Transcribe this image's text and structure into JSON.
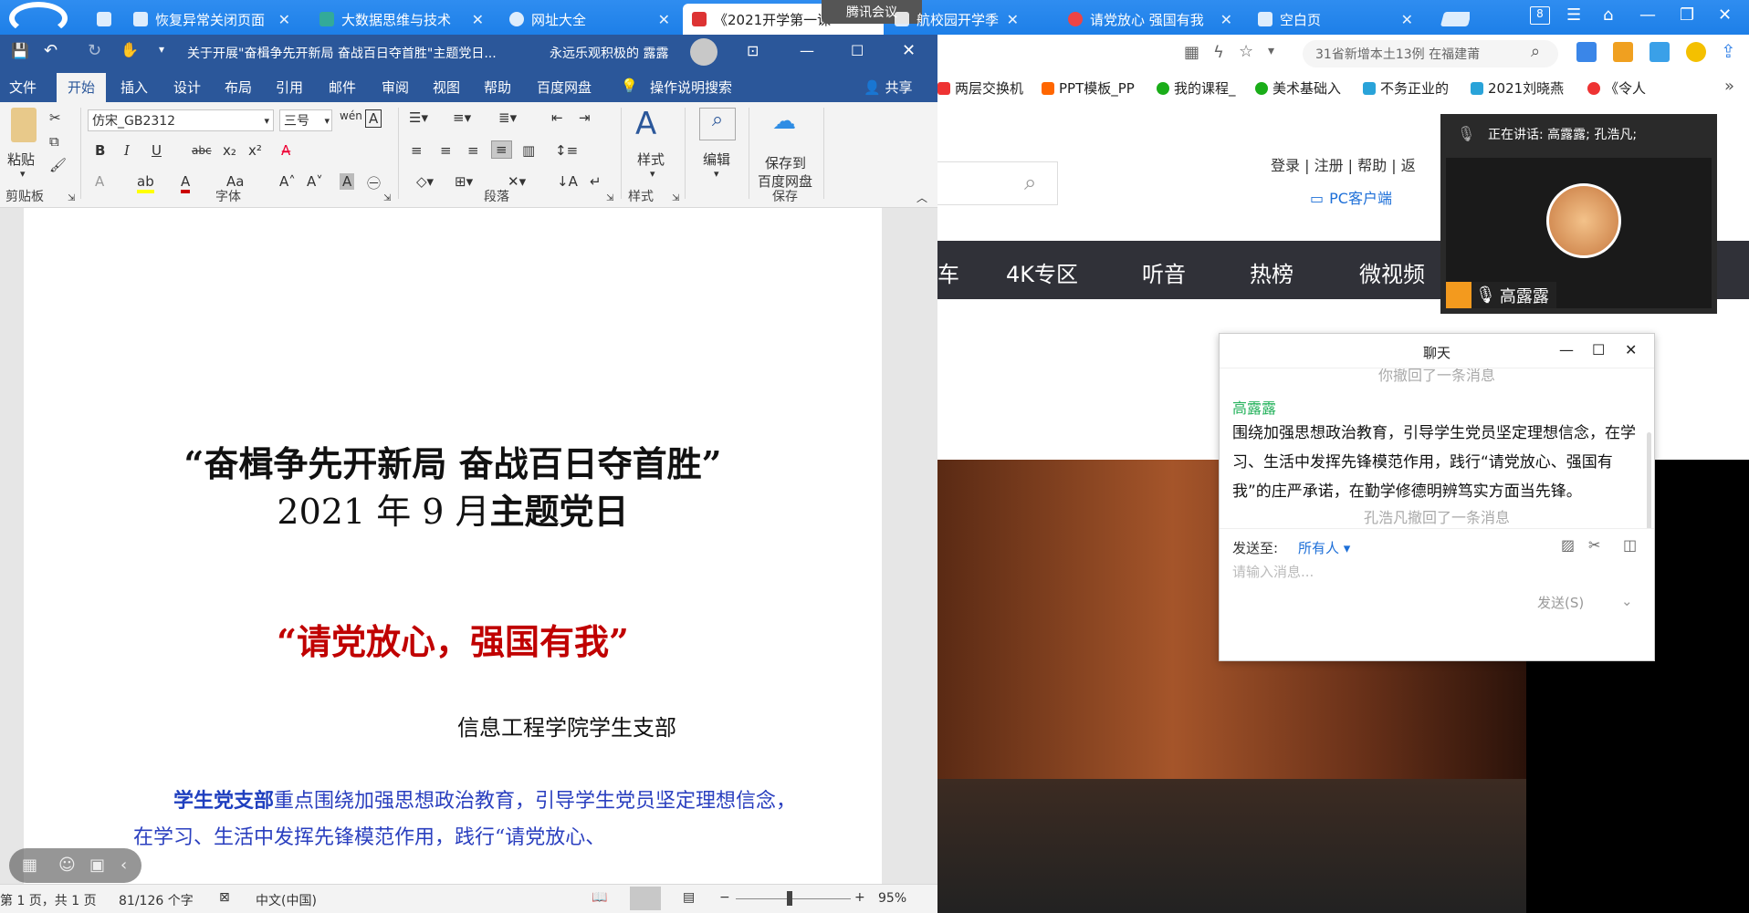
{
  "browser": {
    "tabs": [
      {
        "label": "恢复异常关闭页面"
      },
      {
        "label": "大数据思维与技术"
      },
      {
        "label": "网址大全"
      },
      {
        "label": "《2021开学第一课"
      },
      {
        "label": "航校园开学季 \"泛"
      },
      {
        "label": "请党放心 强国有我"
      },
      {
        "label": "空白页"
      }
    ],
    "meeting_app_label": "腾讯会议",
    "tab_counter": "8",
    "address_text": "31省新增本土13例 在福建莆",
    "bookmarks": [
      "两层交换机",
      "PPT模板_PP",
      "我的课程_",
      "美术基础入",
      "不务正业的",
      "2021刘晓燕",
      "《令人"
    ]
  },
  "website": {
    "login": "登录",
    "register": "注册",
    "help": "帮助",
    "back": "返",
    "pc_client": "PC客户端",
    "nav": [
      "车",
      "4K专区",
      "听音",
      "热榜",
      "微视频"
    ]
  },
  "word": {
    "title": "关于开展\"奋楫争先开新局  奋战百日夺首胜\"主题党日...",
    "user": "永远乐观积极的 露露",
    "tabs": [
      "文件",
      "开始",
      "插入",
      "设计",
      "布局",
      "引用",
      "邮件",
      "审阅",
      "视图",
      "帮助",
      "百度网盘"
    ],
    "tell_me": "操作说明搜索",
    "share": "共享",
    "ribbon": {
      "paste": "粘贴",
      "font_name": "仿宋_GB2312",
      "font_size": "三号",
      "styles": "样式",
      "edit": "编辑",
      "save_baidu": "保存到",
      "save_baidu2": "百度网盘",
      "groups": {
        "clipboard": "剪贴板",
        "font": "字体",
        "paragraph": "段落",
        "style": "样式",
        "save": "保存"
      }
    },
    "doc": {
      "title_line1": "“奋楫争先开新局  奋战百日夺首胜”",
      "title_line2_a": "2021 年 9 月",
      "title_line2_b": "主题党日",
      "slogan": "“请党放心，强国有我”",
      "org": "信息工程学院学生支部",
      "body_lead": "学生党支部",
      "body_rest": "重点围绕加强思想政治教育，引导学生党员坚定理想信念，在学习、生活中发挥先锋模范作用，践行“请党放心、"
    },
    "status": {
      "page": "第 1 页，共 1 页",
      "words": "81/126 个字",
      "language": "中文(中国)",
      "zoom": "95%"
    }
  },
  "meeting": {
    "speaking": "正在讲话: 高露露; 孔浩凡;",
    "participant_name": "高露露"
  },
  "chat": {
    "title": "聊天",
    "sys_recall_you": "你撤回了一条消息",
    "sender": "高露露",
    "message": "围绕加强思想政治教育，引导学生党员坚定理想信念，在学习、生活中发挥先锋模范作用，践行“请党放心、强国有我”的庄严承诺，在勤学修德明辨笃实方面当先锋。",
    "sys_recall_other": "孔浩凡撤回了一条消息",
    "send_to_label": "发送至:",
    "send_to_value": "所有人",
    "input_placeholder": "请输入消息...",
    "send_button": "发送(S)"
  }
}
